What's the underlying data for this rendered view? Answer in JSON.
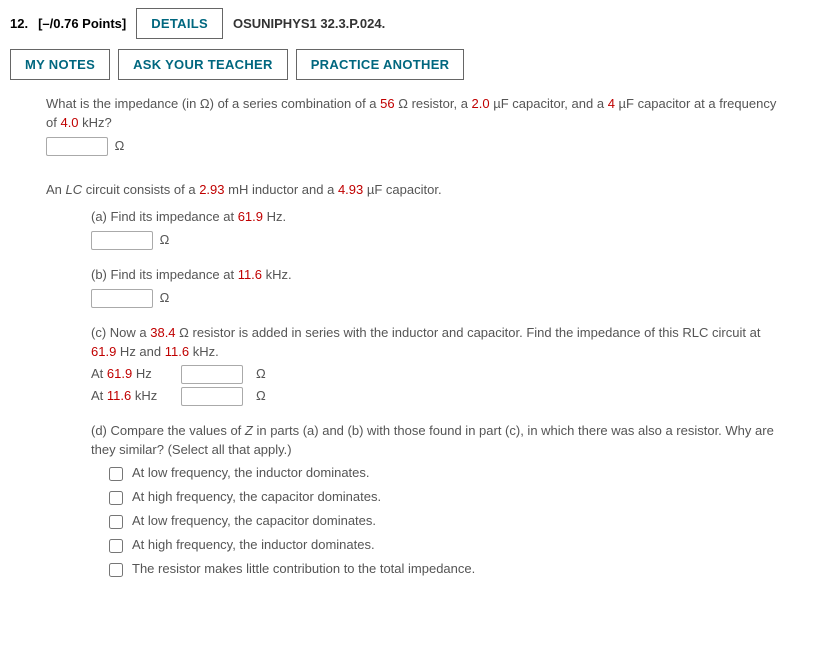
{
  "header": {
    "number": "12.",
    "points": "[–/0.76 Points]",
    "details_btn": "DETAILS",
    "source": "OSUNIPHYS1 32.3.P.024."
  },
  "buttons": {
    "mynotes": "MY NOTES",
    "ask": "ASK YOUR TEACHER",
    "practice": "PRACTICE ANOTHER"
  },
  "q1": {
    "pre1": "What is the impedance (in Ω) of a series combination of a ",
    "r": "56",
    "mid1": " Ω resistor, a ",
    "c1": "2.0",
    "mid2": " µF capacitor, and a ",
    "c2": "4",
    "mid3": " µF capacitor at a frequency of ",
    "f": "4.0",
    "post": " kHz?",
    "unit": "Ω"
  },
  "q2": {
    "intro_pre": "An ",
    "intro_lc": "LC",
    "intro_mid1": " circuit consists of a ",
    "L": "2.93",
    "intro_mid2": " mH inductor and a ",
    "C": "4.93",
    "intro_post": " µF capacitor.",
    "a": {
      "label": "(a) Find its impedance at ",
      "f": "61.9",
      "post": " Hz.",
      "unit": "Ω"
    },
    "b": {
      "label": "(b) Find its impedance at ",
      "f": "11.6",
      "post": " kHz.",
      "unit": "Ω"
    },
    "c": {
      "pre": "(c) Now a ",
      "R": "38.4",
      "mid": " Ω resistor is added in series with the inductor and capacitor. Find the impedance of this RLC circuit at ",
      "f1": "61.9",
      "mid2": " Hz and ",
      "f2": "11.6",
      "post": " kHz.",
      "row1_pre": "At ",
      "row1_f": "61.9",
      "row1_post": " Hz",
      "row1_unit": "Ω",
      "row2_pre": "At ",
      "row2_f": "11.6",
      "row2_post": " kHz",
      "row2_unit": "Ω"
    },
    "d": {
      "text_pre": "(d) Compare the values of ",
      "z": "Z",
      "text_post": " in parts (a) and (b) with those found in part (c), in which there was also a resistor. Why are they similar? (Select all that apply.)",
      "opts": [
        "At low frequency, the inductor dominates.",
        "At high frequency, the capacitor dominates.",
        "At low frequency, the capacitor dominates.",
        "At high frequency, the inductor dominates.",
        "The resistor makes little contribution to the total impedance."
      ]
    }
  }
}
